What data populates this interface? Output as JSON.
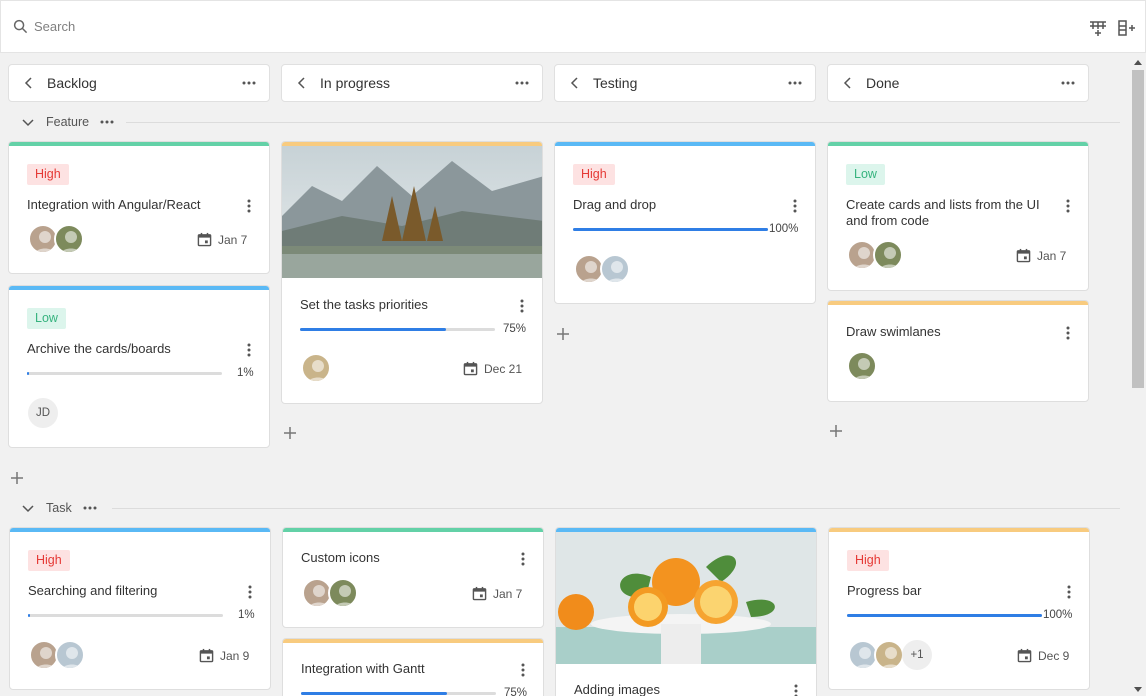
{
  "search": {
    "placeholder": "Search"
  },
  "columns": [
    {
      "title": "Backlog"
    },
    {
      "title": "In progress"
    },
    {
      "title": "Testing"
    },
    {
      "title": "Done"
    }
  ],
  "lanes": [
    {
      "title": "Feature"
    },
    {
      "title": "Task"
    }
  ],
  "cards": {
    "c1": {
      "priority": "High",
      "title": "Integration with Angular/React",
      "date": "Jan 7"
    },
    "c2": {
      "priority": "Low",
      "title": "Archive the cards/boards",
      "progress": "1%",
      "initials": "JD"
    },
    "c3": {
      "title": "Set the tasks priorities",
      "progress": "75%",
      "date": "Dec 21"
    },
    "c4": {
      "priority": "High",
      "title": "Drag and drop",
      "progress": "100%"
    },
    "c5": {
      "priority": "Low",
      "title": "Create cards and lists from the UI and from code",
      "date": "Jan 7"
    },
    "c6": {
      "title": "Draw swimlanes"
    },
    "c7": {
      "priority": "High",
      "title": "Searching and filtering",
      "progress": "1%",
      "date": "Jan 9"
    },
    "c8": {
      "title": "Custom icons",
      "date": "Jan 7"
    },
    "c9": {
      "title": "Integration with Gantt",
      "progress": "75%"
    },
    "c10": {
      "title": "Adding images"
    },
    "c11": {
      "priority": "High",
      "title": "Progress bar",
      "progress": "100%",
      "date": "Dec 9",
      "more": "+1"
    }
  },
  "colors": {
    "green": "#63d1a7",
    "blue": "#5ab9f5",
    "orange": "#f8cb7f",
    "accent": "#2f7ee5"
  },
  "icons": [
    "search-icon",
    "add-column-icon",
    "add-row-icon",
    "chevron-left-icon",
    "more-horizontal-icon",
    "chevron-down-icon",
    "more-vertical-icon",
    "calendar-icon",
    "plus-icon"
  ]
}
